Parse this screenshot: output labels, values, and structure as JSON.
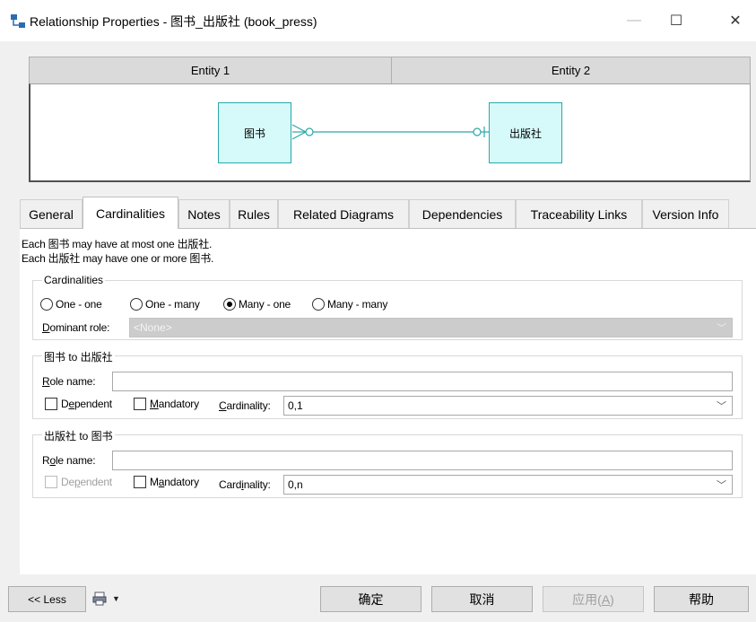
{
  "window": {
    "title": "Relationship Properties - 图书_出版社 (book_press)",
    "minimize_glyph": "—",
    "maximize_glyph": "☐",
    "close_glyph": "✕"
  },
  "entities": {
    "entity1_header": "Entity 1",
    "entity2_header": "Entity 2",
    "entity1_name": "图书",
    "entity2_name": "出版社"
  },
  "tabs": [
    {
      "label": "General"
    },
    {
      "label": "Cardinalities"
    },
    {
      "label": "Notes"
    },
    {
      "label": "Rules"
    },
    {
      "label": "Related Diagrams"
    },
    {
      "label": "Dependencies"
    },
    {
      "label": "Traceability Links"
    },
    {
      "label": "Version Info"
    }
  ],
  "active_tab": "Cardinalities",
  "cardinalities": {
    "description_line1": "Each 图书 may have at most one 出版社.",
    "description_line2": "Each 出版社 may have one or more 图书.",
    "group_label": "Cardinalities",
    "options": [
      {
        "label": "One - one",
        "selected": false
      },
      {
        "label": "One - many",
        "selected": false
      },
      {
        "label": "Many - one",
        "selected": true
      },
      {
        "label": "Many - many",
        "selected": false
      }
    ],
    "dominant_role_label_u": "D",
    "dominant_role_label_rest": "ominant role:",
    "dominant_role_value": "<None>",
    "role1": {
      "group_label": "图书 to 出版社",
      "role_name_u": "R",
      "role_name_rest": "ole name:",
      "role_name_value": "",
      "dependent_pre": "D",
      "dependent_u": "e",
      "dependent_post": "pendent",
      "dependent_checked": false,
      "mandatory_u": "M",
      "mandatory_rest": "andatory",
      "mandatory_checked": false,
      "cardinality_u": "C",
      "cardinality_rest": "ardinality:",
      "cardinality_value": "0,1"
    },
    "role2": {
      "group_label": "出版社 to 图书",
      "role_name_pre": "R",
      "role_name_u": "o",
      "role_name_post": "le name:",
      "role_name_value": "",
      "dependent_pre": "De",
      "dependent_u": "p",
      "dependent_post": "endent",
      "dependent_checked": false,
      "dependent_disabled": true,
      "mandatory_pre": "M",
      "mandatory_u": "a",
      "mandatory_post": "ndatory",
      "mandatory_checked": false,
      "cardinality_pre": "Card",
      "cardinality_u": "i",
      "cardinality_post": "nality:",
      "cardinality_value": "0,n"
    }
  },
  "footer": {
    "less_label": "<< Less",
    "ok_label": "确定",
    "cancel_label": "取消",
    "apply_pre": "应用(",
    "apply_u": "A",
    "apply_post": ")",
    "help_label": "帮助"
  },
  "colors": {
    "entity_fill": "#d6fafa",
    "entity_border": "#2aa8a8"
  }
}
